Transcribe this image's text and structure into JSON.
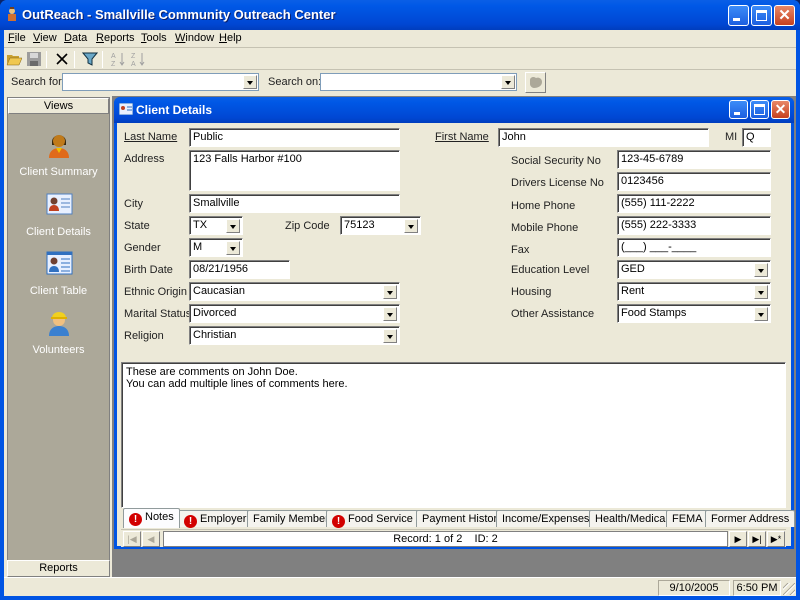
{
  "window": {
    "title": "OutReach - Smallville Community Outreach Center"
  },
  "menu": [
    "File",
    "View",
    "Data",
    "Reports",
    "Tools",
    "Window",
    "Help"
  ],
  "menu_underline": [
    "F",
    "V",
    "D",
    "R",
    "T",
    "W",
    "H"
  ],
  "toolbar": {
    "icons": [
      "open-folder-icon",
      "save-icon",
      "delete-icon",
      "filter-icon",
      "sort-ascending-icon",
      "sort-descending-icon"
    ]
  },
  "search": {
    "search_for_label": "Search for:",
    "search_for_value": "",
    "search_on_label": "Search on:",
    "search_on_value": ""
  },
  "views": {
    "header": "Views",
    "items": [
      {
        "label": "Client Summary",
        "icon": "person-icon"
      },
      {
        "label": "Client Details",
        "icon": "contact-card-icon"
      },
      {
        "label": "Client Table",
        "icon": "contact-table-icon"
      },
      {
        "label": "Volunteers",
        "icon": "volunteer-icon"
      }
    ],
    "reports_label": "Reports"
  },
  "client_details": {
    "title": "Client Details",
    "fields": {
      "last_name": {
        "label": "Last Name",
        "value": "Public"
      },
      "first_name": {
        "label": "First Name",
        "value": "John"
      },
      "mi": {
        "label": "MI",
        "value": "Q"
      },
      "address": {
        "label": "Address",
        "value": "123 Falls Harbor #100"
      },
      "city": {
        "label": "City",
        "value": "Smallville"
      },
      "state": {
        "label": "State",
        "value": "TX"
      },
      "zip": {
        "label": "Zip Code",
        "value": "75123"
      },
      "gender": {
        "label": "Gender",
        "value": "M"
      },
      "birth_date": {
        "label": "Birth Date",
        "value": "08/21/1956"
      },
      "ethnic_origin": {
        "label": "Ethnic Origin",
        "value": "Caucasian"
      },
      "marital_status": {
        "label": "Marital Status",
        "value": "Divorced"
      },
      "religion": {
        "label": "Religion",
        "value": "Christian"
      },
      "ssn": {
        "label": "Social Security No",
        "value": "123-45-6789"
      },
      "drivers_license": {
        "label": "Drivers License No",
        "value": "0123456"
      },
      "home_phone": {
        "label": "Home Phone",
        "value": "(555) 111-2222"
      },
      "mobile_phone": {
        "label": "Mobile Phone",
        "value": "(555) 222-3333"
      },
      "fax": {
        "label": "Fax",
        "value": "(___) ___-____"
      },
      "education": {
        "label": "Education Level",
        "value": "GED"
      },
      "housing": {
        "label": "Housing",
        "value": "Rent"
      },
      "other_assistance": {
        "label": "Other Assistance",
        "value": "Food Stamps"
      }
    },
    "notes": {
      "line1": "These are comments on John Doe.",
      "line2": "You can add multiple lines of comments here."
    },
    "tabs": [
      {
        "label": "Notes",
        "warning": true,
        "active": true
      },
      {
        "label": "Employer",
        "warning": true
      },
      {
        "label": "Family Members",
        "warning": false
      },
      {
        "label": "Food Service",
        "warning": true
      },
      {
        "label": "Payment History",
        "warning": false
      },
      {
        "label": "Income/Expenses",
        "warning": false
      },
      {
        "label": "Health/Medical",
        "warning": false
      },
      {
        "label": "FEMA",
        "warning": false
      },
      {
        "label": "Former Address",
        "warning": false
      }
    ],
    "record_nav": {
      "text": "Record: 1 of 2    ID: 2"
    }
  },
  "statusbar": {
    "date": "9/10/2005",
    "time": "6:50 PM"
  }
}
